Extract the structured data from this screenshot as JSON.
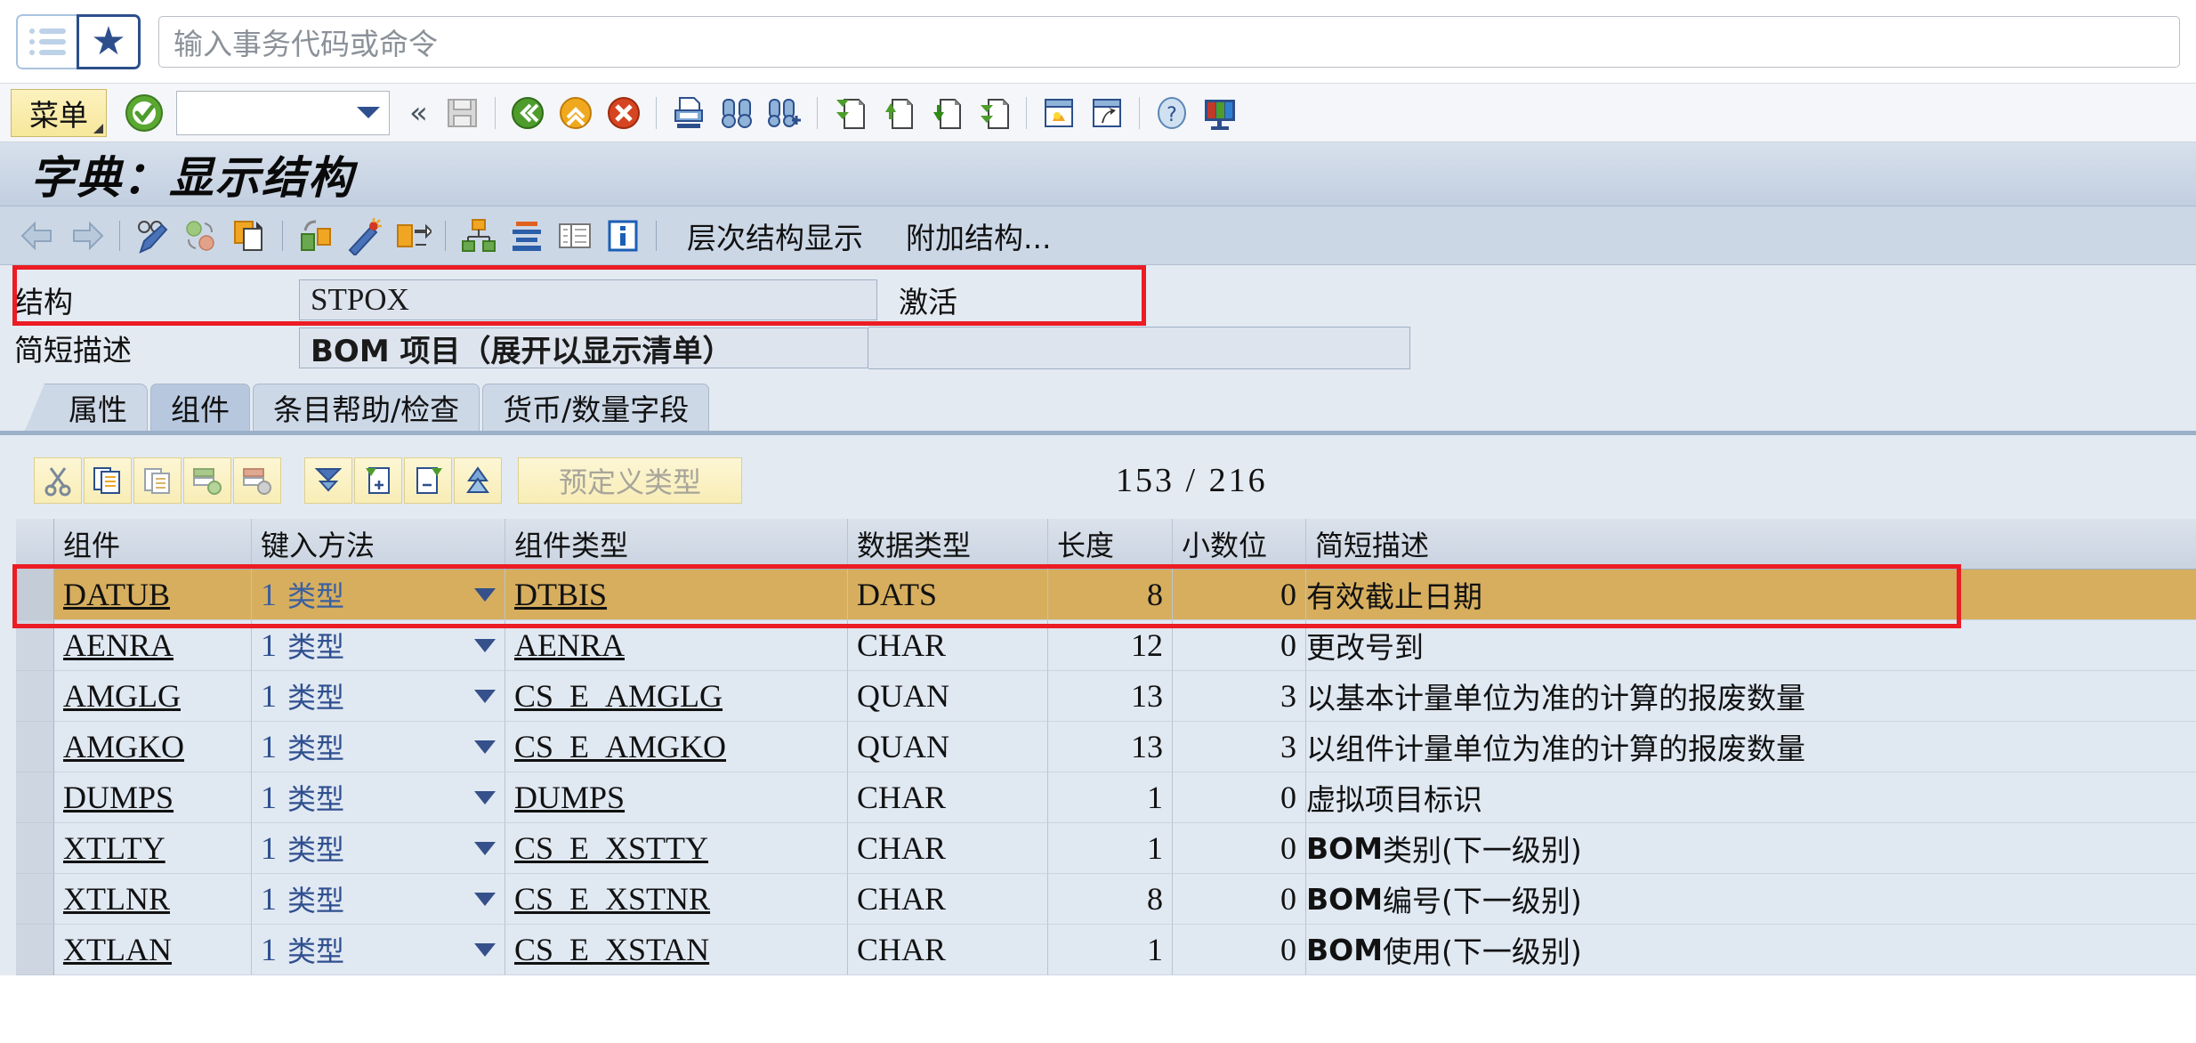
{
  "topbar": {
    "menu_icon": "list-icon",
    "favorites_icon": "star-icon",
    "search_placeholder": "输入事务代码或命令",
    "search_value": ""
  },
  "system_toolbar": {
    "menu_button": "菜单",
    "ok_icon": "green-check-icon",
    "combo_value": "",
    "collapse_icon": "double-chevron-left-icon",
    "icons": [
      "save-icon",
      "back-icon",
      "exit-icon",
      "cancel-icon",
      "print-icon",
      "find-icon",
      "find-next-icon",
      "first-page-icon",
      "previous-page-icon",
      "next-page-icon",
      "last-page-icon",
      "create-session-icon",
      "create-shortcut-icon",
      "help-icon",
      "customize-layout-icon"
    ]
  },
  "title": "字典：显示结构",
  "app_toolbar": {
    "icons": [
      "back-arrow-icon",
      "forward-arrow-icon",
      "display-change-icon",
      "activate-icon",
      "copy-icon",
      "where-used-list-icon",
      "generate-icon",
      "expand-icon",
      "hierarchy-icon",
      "indent-icon",
      "table-view-icon",
      "info-icon"
    ],
    "buttons": [
      "层次结构显示",
      "附加结构..."
    ]
  },
  "form": {
    "structure_label": "结构",
    "structure_value": "STPOX",
    "status": "激活",
    "description_label": "简短描述",
    "description_value": "BOM 项目（展开以显示清单）"
  },
  "tabs": [
    {
      "label": "属性",
      "active": false
    },
    {
      "label": "组件",
      "active": true
    },
    {
      "label": "条目帮助/检查",
      "active": false
    },
    {
      "label": "货币/数量字段",
      "active": false
    }
  ],
  "table_toolbar": {
    "icons": [
      "cut-icon",
      "copy-icon",
      "paste-icon",
      "insert-row-icon",
      "delete-row-icon",
      "filter-icon",
      "insert-before-icon",
      "delete-entry-icon",
      "sort-up-icon"
    ],
    "predefined_type_button": "预定义类型",
    "counter_current": "153",
    "counter_separator": "/",
    "counter_total": "216"
  },
  "grid": {
    "headers": {
      "component": "组件",
      "typing_method": "键入方法",
      "component_type": "组件类型",
      "data_type": "数据类型",
      "length": "长度",
      "decimals": "小数位",
      "short_description": "简短描述"
    },
    "rows": [
      {
        "component": "DATUB",
        "method_num": "1",
        "method_label": "类型",
        "comp_type": "DTBIS",
        "data_type": "DATS",
        "length": "8",
        "decimals": "0",
        "desc_bold": "",
        "desc_rest": "有效截止日期",
        "selected": true
      },
      {
        "component": "AENRA",
        "method_num": "1",
        "method_label": "类型",
        "comp_type": "AENRA",
        "data_type": "CHAR",
        "length": "12",
        "decimals": "0",
        "desc_bold": "",
        "desc_rest": "更改号到",
        "selected": false
      },
      {
        "component": "AMGLG",
        "method_num": "1",
        "method_label": "类型",
        "comp_type": "CS_E_AMGLG",
        "data_type": "QUAN",
        "length": "13",
        "decimals": "3",
        "desc_bold": "",
        "desc_rest": "以基本计量单位为准的计算的报废数量",
        "selected": false
      },
      {
        "component": "AMGKO",
        "method_num": "1",
        "method_label": "类型",
        "comp_type": "CS_E_AMGKO",
        "data_type": "QUAN",
        "length": "13",
        "decimals": "3",
        "desc_bold": "",
        "desc_rest": "以组件计量单位为准的计算的报废数量",
        "selected": false
      },
      {
        "component": "DUMPS",
        "method_num": "1",
        "method_label": "类型",
        "comp_type": "DUMPS",
        "data_type": "CHAR",
        "length": "1",
        "decimals": "0",
        "desc_bold": "",
        "desc_rest": "虚拟项目标识",
        "selected": false
      },
      {
        "component": "XTLTY",
        "method_num": "1",
        "method_label": "类型",
        "comp_type": "CS_E_XSTTY",
        "data_type": "CHAR",
        "length": "1",
        "decimals": "0",
        "desc_bold": "BOM",
        "desc_rest": " 类别(下一级别)",
        "selected": false
      },
      {
        "component": "XTLNR",
        "method_num": "1",
        "method_label": "类型",
        "comp_type": "CS_E_XSTNR",
        "data_type": "CHAR",
        "length": "8",
        "decimals": "0",
        "desc_bold": "BOM",
        "desc_rest": "编号(下一级别)",
        "selected": false
      },
      {
        "component": "XTLAN",
        "method_num": "1",
        "method_label": "类型",
        "comp_type": "CS_E_XSTAN",
        "data_type": "CHAR",
        "length": "1",
        "decimals": "0",
        "desc_bold": "BOM",
        "desc_rest": "使用(下一级别)",
        "selected": false
      }
    ]
  },
  "annotations": {
    "highlight_color": "#ec1c24",
    "selected_row_color": "#d6ae5e"
  }
}
